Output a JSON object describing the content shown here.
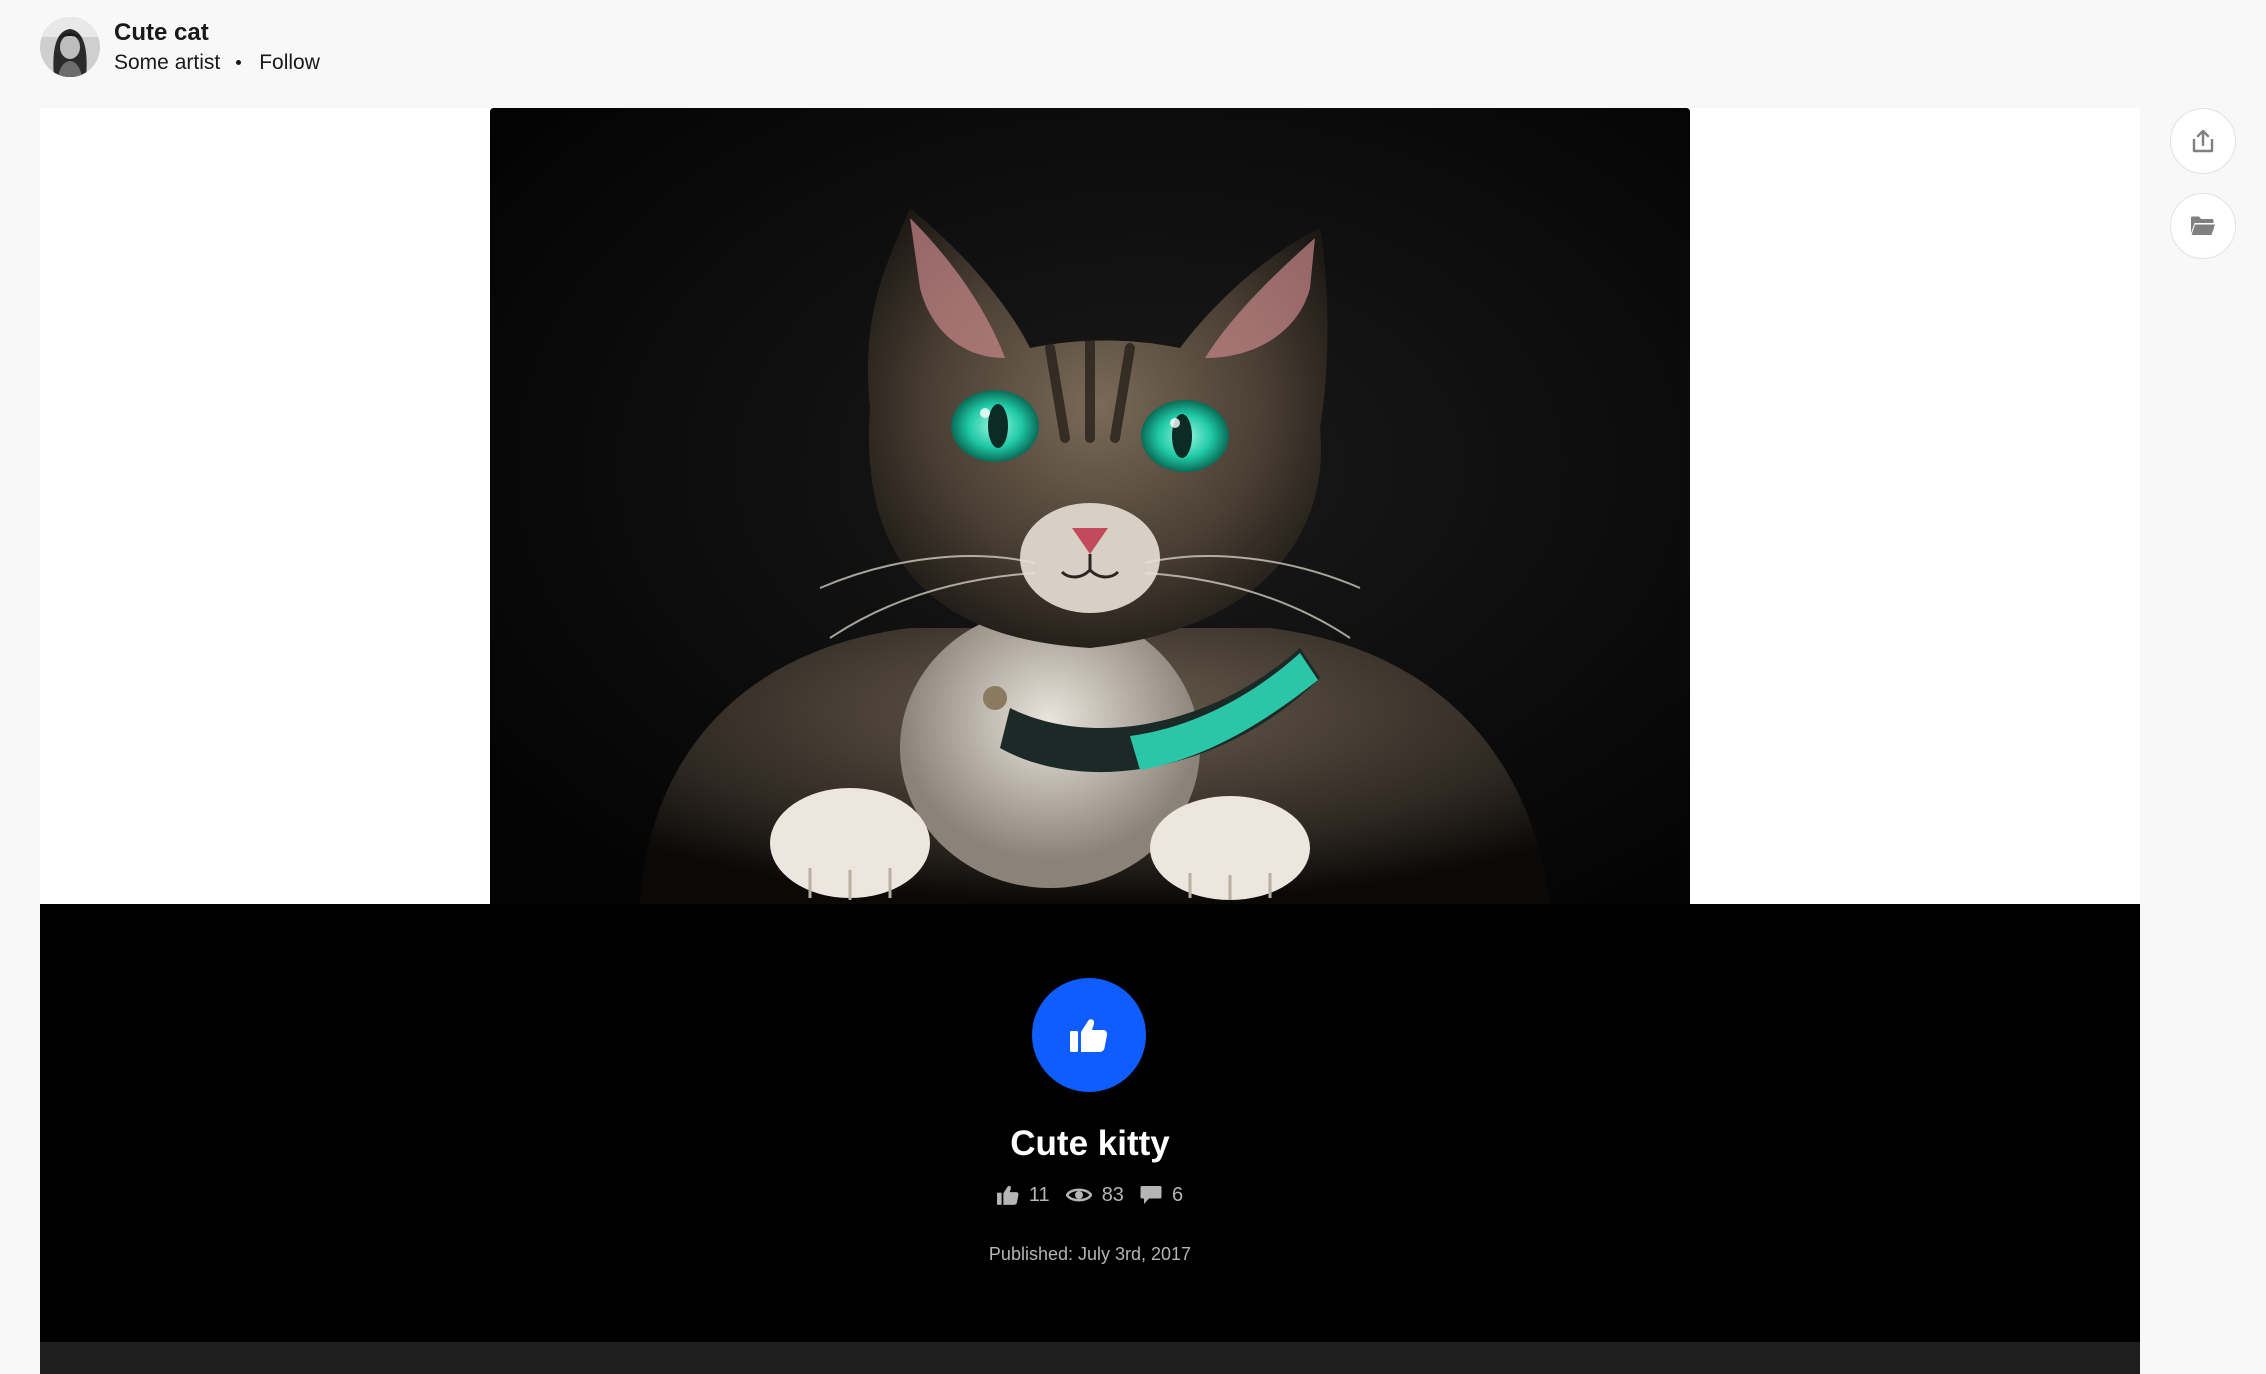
{
  "header": {
    "title": "Cute cat",
    "owner": "Some artist",
    "follow_label": "Follow"
  },
  "project": {
    "image_alt": "tabby cat with green eyes",
    "title": "Cute kitty",
    "stats": {
      "appreciations": "11",
      "views": "83",
      "comments": "6"
    },
    "published": "Published: July 3rd, 2017"
  },
  "icons": {
    "appreciate": "thumbs-up-icon",
    "views": "eye-icon",
    "comments": "speech-bubble-icon",
    "share": "share-icon",
    "save": "folder-icon"
  },
  "colors": {
    "appreciate_button": "#0f5cff",
    "info_panel": "#000000",
    "page_background": "#f8f8f8"
  }
}
